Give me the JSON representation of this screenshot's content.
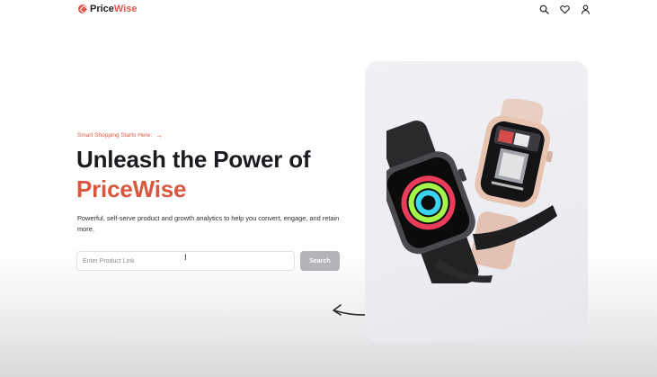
{
  "nav": {
    "brand_prefix": "Price",
    "brand_accent": "Wise",
    "icons": [
      "search-icon",
      "heart-icon",
      "user-icon"
    ]
  },
  "hero": {
    "eyebrow": "Smart Shopping Starts Here:",
    "eyebrow_arrow": "→",
    "headline_line1": "Unleash the Power of",
    "headline_accent": "PriceWise",
    "description": "Powerful, self-serve product and growth analytics to help you convert, engage, and retain more."
  },
  "search": {
    "placeholder": "Enter Product Link",
    "value": "",
    "button_label": "Search"
  },
  "colors": {
    "accent": "#d9573f",
    "button_disabled": "#b3b3b8",
    "text_dark": "#1b1b20"
  },
  "image": {
    "subject": "apple-watch-pair-image"
  }
}
